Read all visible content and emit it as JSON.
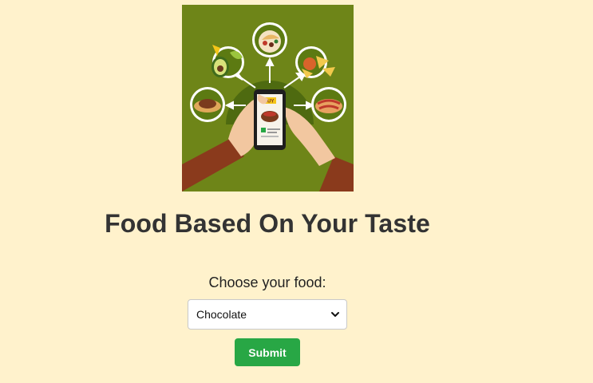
{
  "page": {
    "title": "Food Based On Your Taste"
  },
  "hero": {
    "image_name": "food-ordering-illustration",
    "buy_badge": "BUY"
  },
  "form": {
    "label": "Choose your food:",
    "selected_food": "Chocolate",
    "submit_label": "Submit"
  },
  "colors": {
    "background": "#FFF2CC",
    "title": "#333333",
    "submit": "#28A745",
    "hero_bg": "#6E8518"
  }
}
